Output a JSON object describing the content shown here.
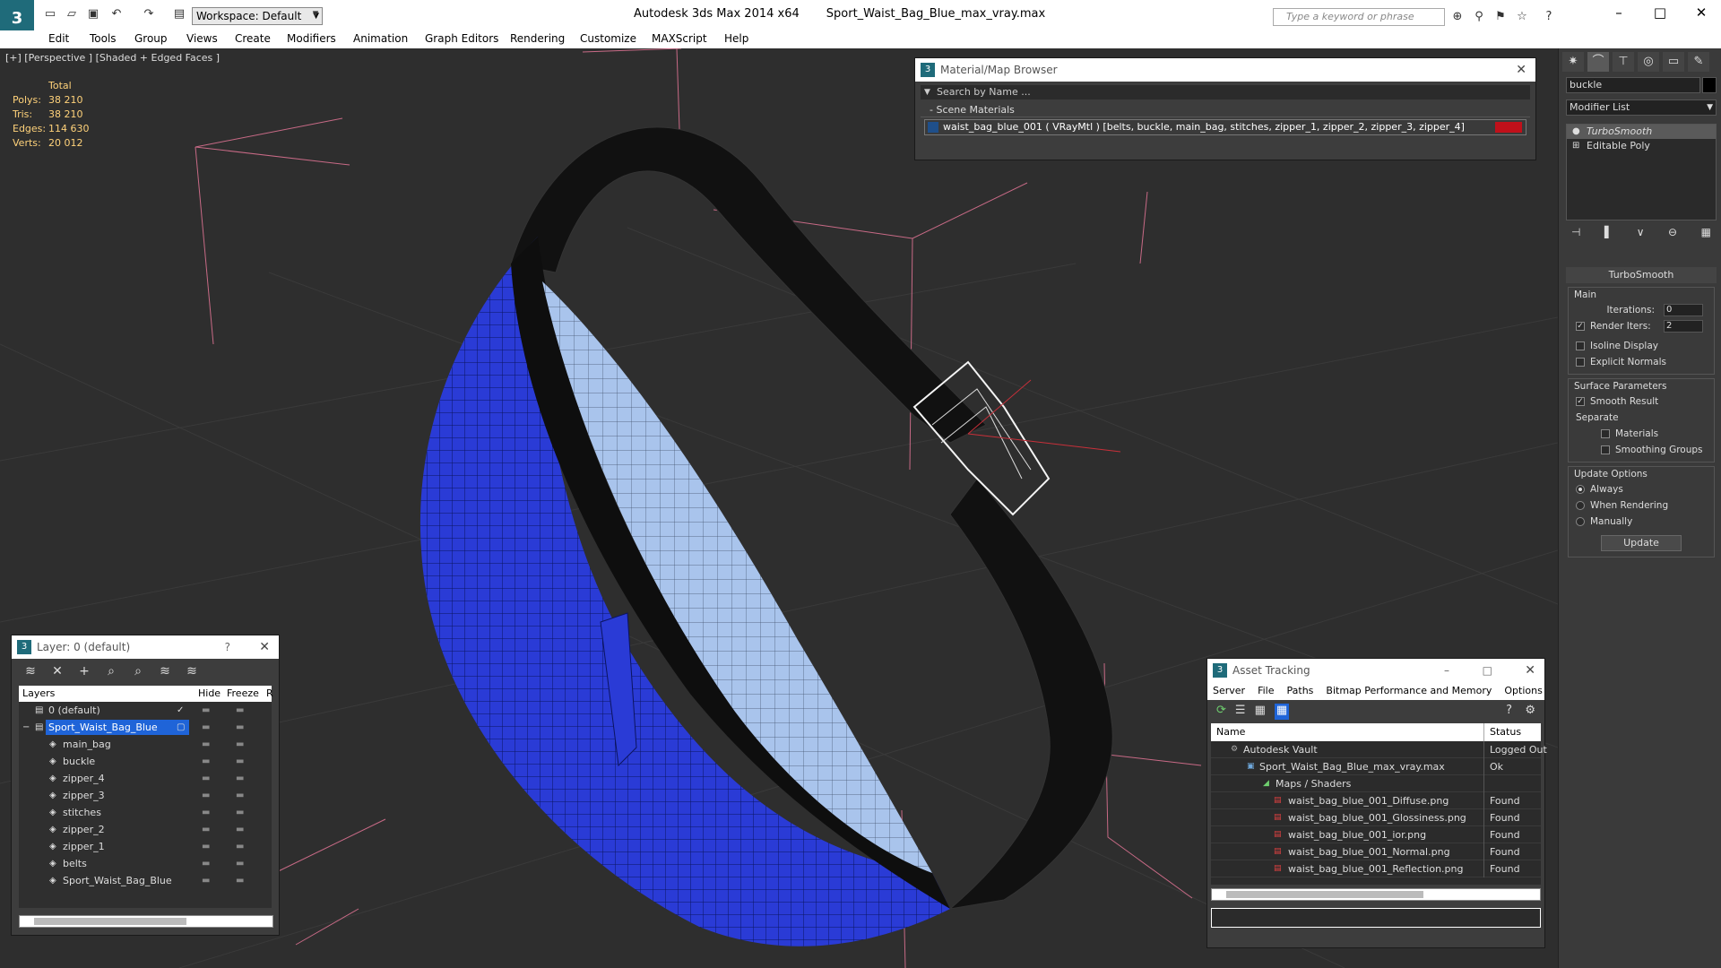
{
  "app": {
    "title": "Autodesk 3ds Max  2014 x64",
    "file": "Sport_Waist_Bag_Blue_max_vray.max",
    "logo": "3ds-max-logo"
  },
  "workspace": {
    "label": "Workspace: Default"
  },
  "search": {
    "placeholder": "Type a keyword or phrase"
  },
  "menu": [
    "Edit",
    "Tools",
    "Group",
    "Views",
    "Create",
    "Modifiers",
    "Animation",
    "Graph Editors",
    "Rendering",
    "Customize",
    "MAXScript",
    "Help"
  ],
  "viewport": {
    "label": "[+] [Perspective ] [Shaded + Edged Faces ]",
    "stats": {
      "header": "Total",
      "rows": [
        {
          "k": "Polys:",
          "v": "38 210"
        },
        {
          "k": "Tris:",
          "v": "38 210"
        },
        {
          "k": "Edges:",
          "v": "114 630"
        },
        {
          "k": "Verts:",
          "v": "20 012"
        }
      ]
    }
  },
  "command_panel": {
    "object_name": "buckle",
    "modifier_list": "Modifier List",
    "stack": [
      "TurboSmooth",
      "Editable Poly"
    ],
    "rollout": {
      "title": "TurboSmooth",
      "main": "Main",
      "iterations_label": "Iterations:",
      "iterations": "0",
      "render_iters_label": "Render Iters:",
      "render_iters": "2",
      "isoline": "Isoline Display",
      "explicit": "Explicit Normals",
      "surface": "Surface Parameters",
      "smooth_result": "Smooth Result",
      "separate": "Separate",
      "materials": "Materials",
      "smoothing_groups": "Smoothing Groups",
      "update_options": "Update Options",
      "always": "Always",
      "when_rendering": "When Rendering",
      "manually": "Manually",
      "update_btn": "Update"
    }
  },
  "material_browser": {
    "title": "Material/Map Browser",
    "search": "Search by Name ...",
    "section": "- Scene Materials",
    "material": "waist_bag_blue_001  ( VRayMtl )  [belts, buckle, main_bag, stitches, zipper_1, zipper_2, zipper_3, zipper_4]",
    "swatch_color": "#c0101a"
  },
  "layer_panel": {
    "title": "Layer: 0 (default)",
    "help": "?",
    "headers": {
      "layers": "Layers",
      "hide": "Hide",
      "freeze": "Freeze",
      "r": "R"
    },
    "rows": [
      {
        "name": "0 (default)",
        "level": 1,
        "check": "✓"
      },
      {
        "name": "Sport_Waist_Bag_Blue",
        "level": 1,
        "selected": true,
        "check": "▢"
      },
      {
        "name": "main_bag",
        "level": 2
      },
      {
        "name": "buckle",
        "level": 2
      },
      {
        "name": "zipper_4",
        "level": 2
      },
      {
        "name": "zipper_3",
        "level": 2
      },
      {
        "name": "stitches",
        "level": 2
      },
      {
        "name": "zipper_2",
        "level": 2
      },
      {
        "name": "zipper_1",
        "level": 2
      },
      {
        "name": "belts",
        "level": 2
      },
      {
        "name": "Sport_Waist_Bag_Blue",
        "level": 2
      }
    ]
  },
  "asset_tracking": {
    "title": "Asset Tracking",
    "menu": [
      "Server",
      "File",
      "Paths",
      "Bitmap Performance and Memory",
      "Options"
    ],
    "headers": {
      "name": "Name",
      "status": "Status"
    },
    "rows": [
      {
        "name": "Autodesk Vault",
        "status": "Logged Out",
        "indent": 20
      },
      {
        "name": "Sport_Waist_Bag_Blue_max_vray.max",
        "status": "Ok",
        "indent": 40
      },
      {
        "name": "Maps / Shaders",
        "status": "",
        "indent": 56
      },
      {
        "name": "waist_bag_blue_001_Diffuse.png",
        "status": "Found",
        "indent": 70
      },
      {
        "name": "waist_bag_blue_001_Glossiness.png",
        "status": "Found",
        "indent": 70
      },
      {
        "name": "waist_bag_blue_001_ior.png",
        "status": "Found",
        "indent": 70
      },
      {
        "name": "waist_bag_blue_001_Normal.png",
        "status": "Found",
        "indent": 70
      },
      {
        "name": "waist_bag_blue_001_Reflection.png",
        "status": "Found",
        "indent": 70
      }
    ]
  },
  "colors": {
    "bag": "#2a3bd6",
    "bag_inner": "#a9c4ec",
    "belt": "#111111",
    "selection": "#1f64d8"
  }
}
